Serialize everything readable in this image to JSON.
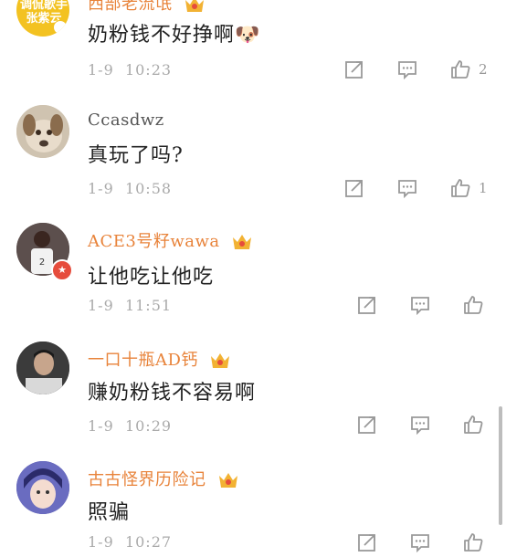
{
  "comments": [
    {
      "username": "西部老流氓",
      "text": "奶粉钱不好挣啊🐶",
      "date": "1-9",
      "time": "10:23",
      "likes": "2",
      "avatar_text": "调侃歌手\n张紫云"
    },
    {
      "username": "Ccasdwz",
      "text": "真玩了吗?",
      "date": "1-9",
      "time": "10:58",
      "likes": "1"
    },
    {
      "username": "ACE3号籽wawa",
      "text": "让他吃让他吃",
      "date": "1-9",
      "time": "11:51",
      "likes": ""
    },
    {
      "username": "一口十瓶AD钙",
      "text": "赚奶粉钱不容易啊",
      "date": "1-9",
      "time": "10:29",
      "likes": ""
    },
    {
      "username": "古古怪界历险记",
      "text": "照骗",
      "date": "1-9",
      "time": "10:27",
      "likes": ""
    }
  ],
  "colors": {
    "vip_name": "#e8833a",
    "meta": "#aaaaaa",
    "icon": "#999999"
  },
  "icons": {
    "share": "share-icon",
    "comment": "comment-icon",
    "like": "thumbs-up-icon",
    "crown": "vip-crown-icon"
  }
}
